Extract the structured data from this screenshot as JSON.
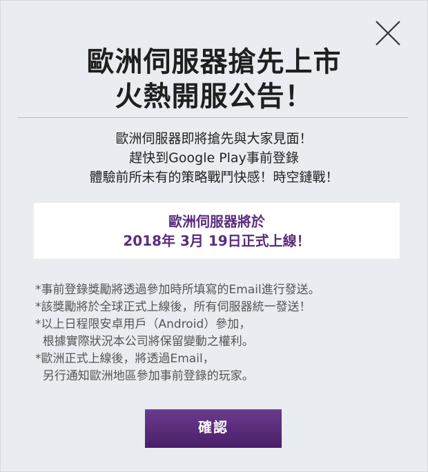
{
  "title": {
    "line1": "歐洲伺服器搶先上市",
    "line2": "火熱開服公告！"
  },
  "intro": {
    "line1": "歐洲伺服器即將搶先與大家見面！",
    "line2": "趕快到Google Play事前登錄",
    "line3": "體驗前所未有的策略戰鬥快感！時空鏈戰！"
  },
  "notice": {
    "line1": "歐洲伺服器將於",
    "line2": "2018年 3月 19日正式上線！"
  },
  "notes": [
    "*事前登錄獎勵將透過參加時所填寫的Email進行發送。",
    "*該獎勵將於全球正式上線後，所有伺服器統一發送！",
    "*以上日程限安卓用戶（Android）參加，",
    "  根據實際狀況本公司將保留變動之權利。",
    "*歐洲正式上線後，將透過Email，",
    "  另行通知歐洲地區參加事前登錄的玩家。"
  ],
  "buttons": {
    "confirm_label": "確認",
    "close_icon": "close-icon"
  },
  "colors": {
    "accent": "#5a2d7e",
    "background": "#e9ecf1",
    "button_top": "#6b3a8e",
    "button_bottom": "#4a1f68"
  }
}
